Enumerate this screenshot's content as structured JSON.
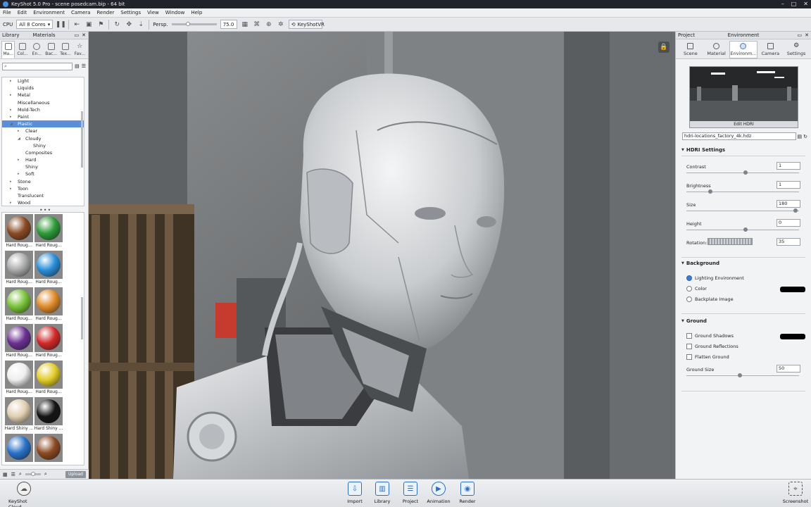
{
  "window": {
    "title": "KeyShot 5.0 Pro - scene posedcam.bip - 64 bit",
    "controls": [
      "–",
      "□",
      "✕"
    ]
  },
  "menu": [
    "File",
    "Edit",
    "Environment",
    "Camera",
    "Render",
    "Settings",
    "View",
    "Window",
    "Help"
  ],
  "toolbar": {
    "cpu_label": "CPU",
    "cores_value": "All 8 Cores",
    "persp_label": "Persp.",
    "fov_value": "75.0",
    "keyshotvr_label": "KeyShotVR"
  },
  "left_panel": {
    "header_left": "Library",
    "header_title": "Materials",
    "tabs": [
      "Ma...",
      "Col...",
      "En...",
      "Bac...",
      "Tex...",
      "Fav..."
    ],
    "tree": [
      {
        "label": "Light",
        "indent": 1,
        "arrow": "▸"
      },
      {
        "label": "Liquids",
        "indent": 1,
        "arrow": ""
      },
      {
        "label": "Metal",
        "indent": 1,
        "arrow": "▸"
      },
      {
        "label": "Miscellaneous",
        "indent": 1,
        "arrow": ""
      },
      {
        "label": "Mold-Tech",
        "indent": 1,
        "arrow": "▸"
      },
      {
        "label": "Paint",
        "indent": 1,
        "arrow": "▸"
      },
      {
        "label": "Plastic",
        "indent": 1,
        "arrow": "◢",
        "selected": true
      },
      {
        "label": "Clear",
        "indent": 2,
        "arrow": "▸"
      },
      {
        "label": "Cloudy",
        "indent": 2,
        "arrow": "◢"
      },
      {
        "label": "Shiny",
        "indent": 3,
        "arrow": ""
      },
      {
        "label": "Composites",
        "indent": 2,
        "arrow": ""
      },
      {
        "label": "Hard",
        "indent": 2,
        "arrow": "▸"
      },
      {
        "label": "Shiny",
        "indent": 2,
        "arrow": ""
      },
      {
        "label": "Soft",
        "indent": 2,
        "arrow": "▸"
      },
      {
        "label": "Stone",
        "indent": 1,
        "arrow": "▸"
      },
      {
        "label": "Toon",
        "indent": 1,
        "arrow": "▸"
      },
      {
        "label": "Translucent",
        "indent": 1,
        "arrow": ""
      },
      {
        "label": "Wood",
        "indent": 1,
        "arrow": "▸"
      }
    ],
    "swatches": [
      {
        "label": "Hard Roug...",
        "color": "#8a4a24"
      },
      {
        "label": "Hard Roug...",
        "color": "#2e9a38"
      },
      {
        "label": "Hard Roug...",
        "color": "#a9aaab"
      },
      {
        "label": "Hard Roug...",
        "color": "#2a8ed8"
      },
      {
        "label": "Hard Roug...",
        "color": "#78c238"
      },
      {
        "label": "Hard Roug...",
        "color": "#e08a28"
      },
      {
        "label": "Hard Roug...",
        "color": "#6a3092"
      },
      {
        "label": "Hard Roug...",
        "color": "#d02a2a"
      },
      {
        "label": "Hard Roug...",
        "color": "#eeeeee"
      },
      {
        "label": "Hard Roug...",
        "color": "#e2cc2a"
      },
      {
        "label": "Hard Shiny ...",
        "color": "#e0cfb0"
      },
      {
        "label": "Hard Shiny ...",
        "color": "#141414"
      },
      {
        "label": "",
        "color": "#2a72c8"
      },
      {
        "label": "",
        "color": "#8c4a22"
      }
    ],
    "upload_label": "Upload"
  },
  "right_panel": {
    "header_left": "Project",
    "header_title": "Environment",
    "tabs": [
      "Scene",
      "Material",
      "Environm...",
      "Camera",
      "Settings"
    ],
    "hdri_caption": "Edit HDRI",
    "hdri_file": "hdri-locations_factory_4k.hdz",
    "hdri_section": "HDRI Settings",
    "props": [
      {
        "label": "Contrast",
        "value": "1",
        "level": 0.52
      },
      {
        "label": "Brightness",
        "value": "1",
        "level": 0.2
      },
      {
        "label": "Size",
        "value": "180",
        "level": 0.98
      },
      {
        "label": "Height",
        "value": "0",
        "level": 0.52
      }
    ],
    "rotation": {
      "label": "Rotation:",
      "value": "35"
    },
    "background_section": "Background",
    "background_options": [
      {
        "label": "Lighting Environment",
        "selected": true
      },
      {
        "label": "Color",
        "selected": false
      },
      {
        "label": "Backplate Image",
        "selected": false
      }
    ],
    "ground_section": "Ground",
    "ground_options": [
      {
        "label": "Ground Shadows",
        "checked": false
      },
      {
        "label": "Ground Reflections",
        "checked": false
      },
      {
        "label": "Flatten Ground",
        "checked": false
      }
    ],
    "ground_size": {
      "label": "Ground Size",
      "value": "50",
      "level": 0.47
    }
  },
  "dock": {
    "cloud_label": "KeyShot Cloud",
    "buttons": [
      "Import",
      "Library",
      "Project",
      "Animation",
      "Render"
    ],
    "screenshot_label": "Screenshot"
  }
}
